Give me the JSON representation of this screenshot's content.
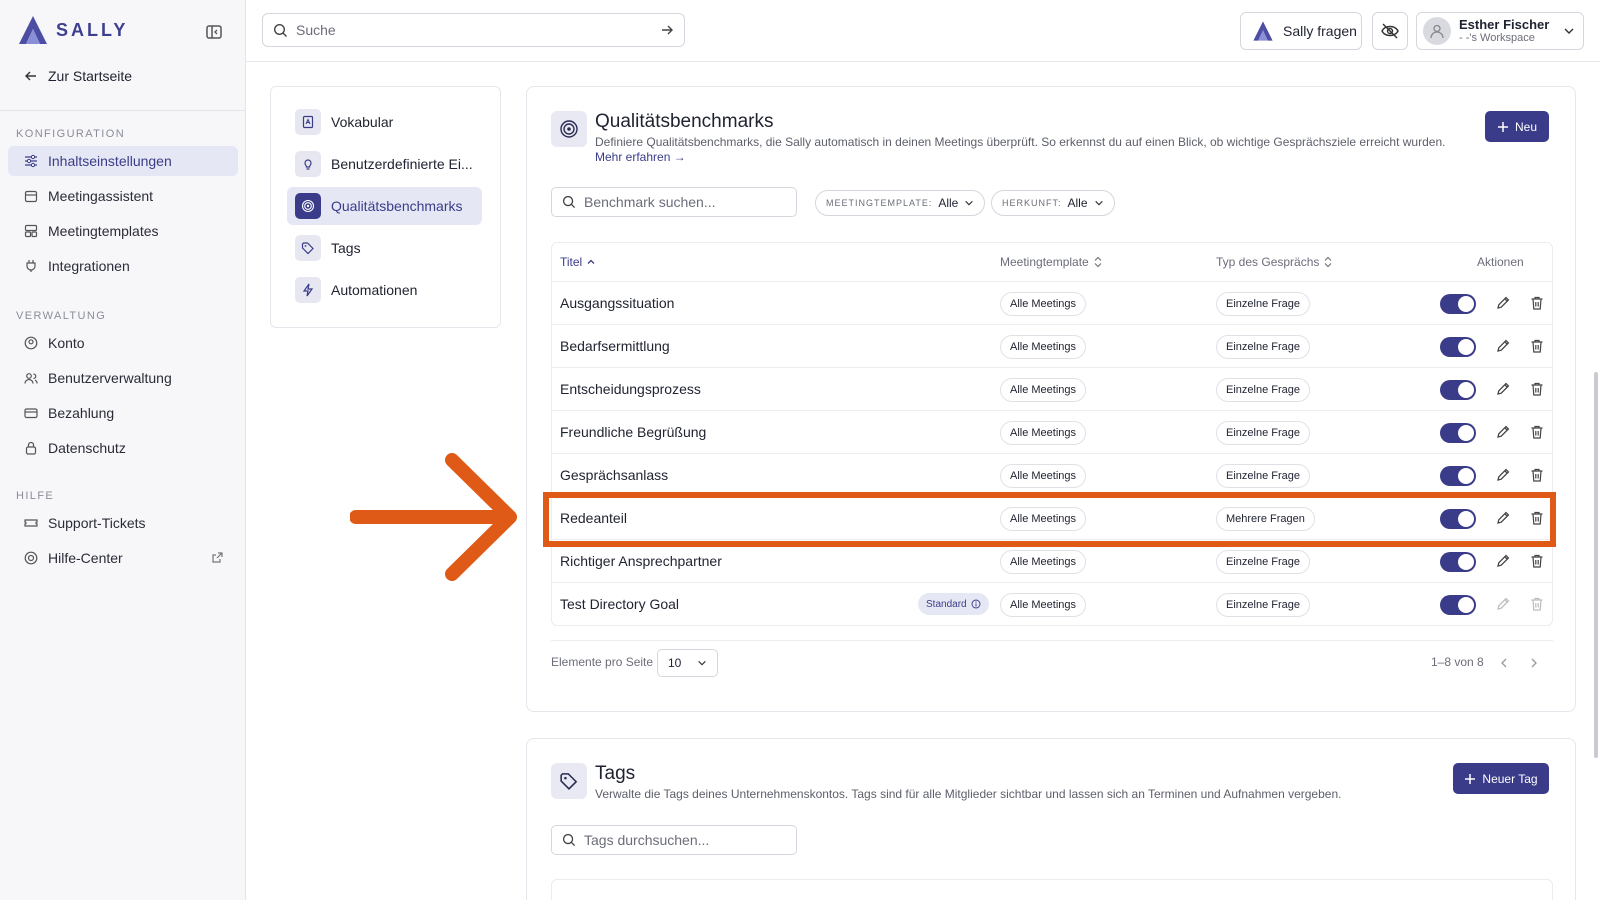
{
  "app": {
    "name": "SALLY",
    "brand_color": "#3a3c8a",
    "highlight_color": "#e05a17"
  },
  "sidebar": {
    "back_label": "Zur Startseite",
    "sections": [
      {
        "title": "KONFIGURATION",
        "items": [
          {
            "label": "Inhaltseinstellungen",
            "icon": "sliders-icon",
            "active": true
          },
          {
            "label": "Meetingassistent",
            "icon": "calendar-icon"
          },
          {
            "label": "Meetingtemplates",
            "icon": "template-icon"
          },
          {
            "label": "Integrationen",
            "icon": "plug-icon"
          }
        ]
      },
      {
        "title": "VERWALTUNG",
        "items": [
          {
            "label": "Konto",
            "icon": "user-circle-icon"
          },
          {
            "label": "Benutzerverwaltung",
            "icon": "users-icon"
          },
          {
            "label": "Bezahlung",
            "icon": "credit-card-icon"
          },
          {
            "label": "Datenschutz",
            "icon": "lock-icon"
          }
        ]
      },
      {
        "title": "HILFE",
        "items": [
          {
            "label": "Support-Tickets",
            "icon": "ticket-icon"
          },
          {
            "label": "Hilfe-Center",
            "icon": "lifebuoy-icon"
          }
        ]
      }
    ]
  },
  "topbar": {
    "search_placeholder": "Suche",
    "ask_label": "Sally fragen",
    "user_name": "Esther Fischer",
    "user_workspace": "- -'s Workspace"
  },
  "subnav": {
    "items": [
      {
        "label": "Vokabular",
        "icon": "book-icon"
      },
      {
        "label": "Benutzerdefinierte Ei...",
        "icon": "lightbulb-icon"
      },
      {
        "label": "Qualitätsbenchmarks",
        "icon": "target-icon",
        "active": true
      },
      {
        "label": "Tags",
        "icon": "tag-icon"
      },
      {
        "label": "Automationen",
        "icon": "lightning-icon"
      }
    ]
  },
  "benchmarks": {
    "title": "Qualitätsbenchmarks",
    "description": "Definiere Qualitätsbenchmarks, die Sally automatisch in deinen Meetings überprüft. So erkennst du auf einen Blick, ob wichtige Gesprächsziele erreicht wurden.",
    "more_link": "Mehr erfahren →",
    "new_label": "Neu",
    "search_placeholder": "Benchmark suchen...",
    "filter_template_label": "MEETINGTEMPLATE:",
    "filter_template_value": "Alle",
    "filter_origin_label": "HERKUNFT:",
    "filter_origin_value": "Alle",
    "columns": {
      "title": "Titel",
      "template": "Meetingtemplate",
      "type": "Typ des Gesprächs",
      "actions": "Aktionen"
    },
    "rows": [
      {
        "title": "Ausgangssituation",
        "template": "Alle Meetings",
        "type": "Einzelne Frage",
        "enabled": true
      },
      {
        "title": "Bedarfsermittlung",
        "template": "Alle Meetings",
        "type": "Einzelne Frage",
        "enabled": true
      },
      {
        "title": "Entscheidungsprozess",
        "template": "Alle Meetings",
        "type": "Einzelne Frage",
        "enabled": true
      },
      {
        "title": "Freundliche Begrüßung",
        "template": "Alle Meetings",
        "type": "Einzelne Frage",
        "enabled": true
      },
      {
        "title": "Gesprächsanlass",
        "template": "Alle Meetings",
        "type": "Einzelne Frage",
        "enabled": true
      },
      {
        "title": "Redeanteil",
        "template": "Alle Meetings",
        "type": "Mehrere Fragen",
        "enabled": true,
        "highlighted": true
      },
      {
        "title": "Richtiger Ansprechpartner",
        "template": "Alle Meetings",
        "type": "Einzelne Frage",
        "enabled": true
      },
      {
        "title": "Test Directory Goal",
        "badge": "Standard",
        "template": "Alle Meetings",
        "type": "Einzelne Frage",
        "enabled": true,
        "locked": true
      }
    ],
    "per_page_label": "Elemente pro Seite",
    "per_page_value": "10",
    "range_label": "1–8 von 8"
  },
  "tags": {
    "title": "Tags",
    "description": "Verwalte die Tags deines Unternehmenskontos. Tags sind für alle Mitglieder sichtbar und lassen sich an Terminen und Aufnahmen vergeben.",
    "new_label": "Neuer Tag",
    "search_placeholder": "Tags durchsuchen..."
  }
}
